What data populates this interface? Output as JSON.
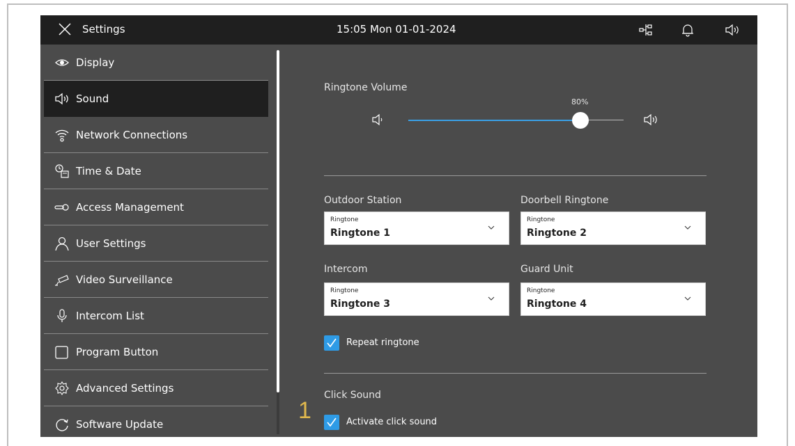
{
  "topbar": {
    "title": "Settings",
    "datetime": "15:05  Mon 01-01-2024",
    "icons": [
      "close-icon",
      "network-topology-icon",
      "bell-icon",
      "speaker-icon"
    ]
  },
  "sidebar": {
    "items": [
      {
        "label": "Display",
        "icon": "eye-icon",
        "active": false
      },
      {
        "label": "Sound",
        "icon": "speaker-icon",
        "active": true
      },
      {
        "label": "Network Connections",
        "icon": "wifi-icon",
        "active": false
      },
      {
        "label": "Time & Date",
        "icon": "clock-calendar-icon",
        "active": false
      },
      {
        "label": "Access Management",
        "icon": "key-icon",
        "active": false
      },
      {
        "label": "User Settings",
        "icon": "user-icon",
        "active": false
      },
      {
        "label": "Video Surveillance",
        "icon": "camera-icon",
        "active": false
      },
      {
        "label": "Intercom List",
        "icon": "microphone-icon",
        "active": false
      },
      {
        "label": "Program Button",
        "icon": "square-icon",
        "active": false
      },
      {
        "label": "Advanced Settings",
        "icon": "gear-icon",
        "active": false
      },
      {
        "label": "Software Update",
        "icon": "refresh-icon",
        "active": false
      }
    ]
  },
  "main": {
    "ringtone_volume": {
      "label": "Ringtone Volume",
      "value_text": "80%",
      "value": 0.8
    },
    "outdoor_station": {
      "label": "Outdoor Station",
      "caption": "Ringtone",
      "value": "Ringtone 1"
    },
    "doorbell_ringtone": {
      "label": "Doorbell Ringtone",
      "caption": "Ringtone",
      "value": "Ringtone 2"
    },
    "intercom": {
      "label": "Intercom",
      "caption": "Ringtone",
      "value": "Ringtone 3"
    },
    "guard_unit": {
      "label": "Guard Unit",
      "caption": "Ringtone",
      "value": "Ringtone 4"
    },
    "repeat_ringtone": {
      "label": "Repeat ringtone",
      "checked": true
    },
    "click_sound": {
      "label": "Click Sound",
      "activate_label": "Activate click sound",
      "checked": true
    }
  },
  "callout": "1",
  "colors": {
    "topbar_bg": "#1f1f1f",
    "panel_bg": "#4b4b4b",
    "accent": "#2e9be6",
    "callout": "#e0b84d"
  }
}
